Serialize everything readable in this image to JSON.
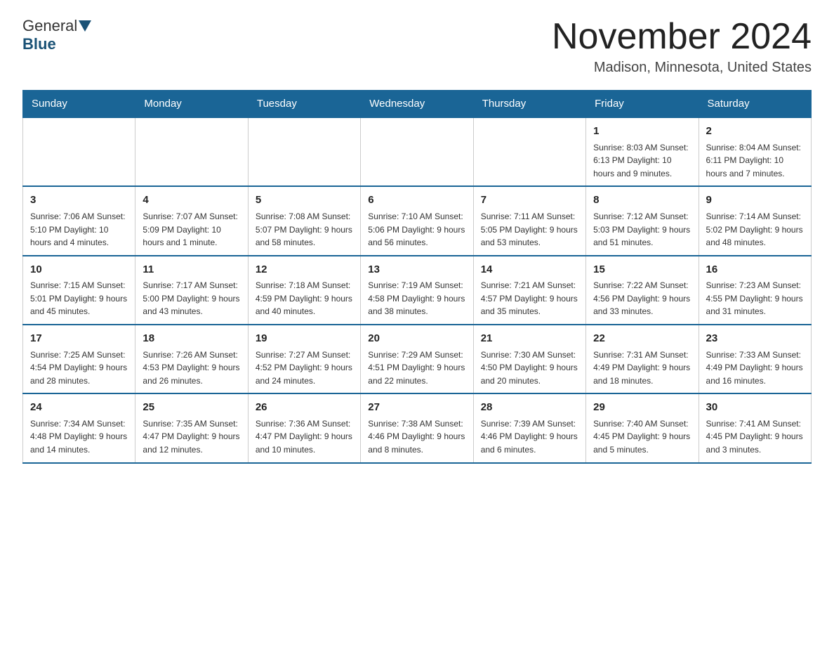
{
  "header": {
    "logo_general": "General",
    "logo_blue": "Blue",
    "month_title": "November 2024",
    "location": "Madison, Minnesota, United States"
  },
  "calendar": {
    "days_of_week": [
      "Sunday",
      "Monday",
      "Tuesday",
      "Wednesday",
      "Thursday",
      "Friday",
      "Saturday"
    ],
    "weeks": [
      [
        {
          "day": "",
          "info": ""
        },
        {
          "day": "",
          "info": ""
        },
        {
          "day": "",
          "info": ""
        },
        {
          "day": "",
          "info": ""
        },
        {
          "day": "",
          "info": ""
        },
        {
          "day": "1",
          "info": "Sunrise: 8:03 AM\nSunset: 6:13 PM\nDaylight: 10 hours and 9 minutes."
        },
        {
          "day": "2",
          "info": "Sunrise: 8:04 AM\nSunset: 6:11 PM\nDaylight: 10 hours and 7 minutes."
        }
      ],
      [
        {
          "day": "3",
          "info": "Sunrise: 7:06 AM\nSunset: 5:10 PM\nDaylight: 10 hours and 4 minutes."
        },
        {
          "day": "4",
          "info": "Sunrise: 7:07 AM\nSunset: 5:09 PM\nDaylight: 10 hours and 1 minute."
        },
        {
          "day": "5",
          "info": "Sunrise: 7:08 AM\nSunset: 5:07 PM\nDaylight: 9 hours and 58 minutes."
        },
        {
          "day": "6",
          "info": "Sunrise: 7:10 AM\nSunset: 5:06 PM\nDaylight: 9 hours and 56 minutes."
        },
        {
          "day": "7",
          "info": "Sunrise: 7:11 AM\nSunset: 5:05 PM\nDaylight: 9 hours and 53 minutes."
        },
        {
          "day": "8",
          "info": "Sunrise: 7:12 AM\nSunset: 5:03 PM\nDaylight: 9 hours and 51 minutes."
        },
        {
          "day": "9",
          "info": "Sunrise: 7:14 AM\nSunset: 5:02 PM\nDaylight: 9 hours and 48 minutes."
        }
      ],
      [
        {
          "day": "10",
          "info": "Sunrise: 7:15 AM\nSunset: 5:01 PM\nDaylight: 9 hours and 45 minutes."
        },
        {
          "day": "11",
          "info": "Sunrise: 7:17 AM\nSunset: 5:00 PM\nDaylight: 9 hours and 43 minutes."
        },
        {
          "day": "12",
          "info": "Sunrise: 7:18 AM\nSunset: 4:59 PM\nDaylight: 9 hours and 40 minutes."
        },
        {
          "day": "13",
          "info": "Sunrise: 7:19 AM\nSunset: 4:58 PM\nDaylight: 9 hours and 38 minutes."
        },
        {
          "day": "14",
          "info": "Sunrise: 7:21 AM\nSunset: 4:57 PM\nDaylight: 9 hours and 35 minutes."
        },
        {
          "day": "15",
          "info": "Sunrise: 7:22 AM\nSunset: 4:56 PM\nDaylight: 9 hours and 33 minutes."
        },
        {
          "day": "16",
          "info": "Sunrise: 7:23 AM\nSunset: 4:55 PM\nDaylight: 9 hours and 31 minutes."
        }
      ],
      [
        {
          "day": "17",
          "info": "Sunrise: 7:25 AM\nSunset: 4:54 PM\nDaylight: 9 hours and 28 minutes."
        },
        {
          "day": "18",
          "info": "Sunrise: 7:26 AM\nSunset: 4:53 PM\nDaylight: 9 hours and 26 minutes."
        },
        {
          "day": "19",
          "info": "Sunrise: 7:27 AM\nSunset: 4:52 PM\nDaylight: 9 hours and 24 minutes."
        },
        {
          "day": "20",
          "info": "Sunrise: 7:29 AM\nSunset: 4:51 PM\nDaylight: 9 hours and 22 minutes."
        },
        {
          "day": "21",
          "info": "Sunrise: 7:30 AM\nSunset: 4:50 PM\nDaylight: 9 hours and 20 minutes."
        },
        {
          "day": "22",
          "info": "Sunrise: 7:31 AM\nSunset: 4:49 PM\nDaylight: 9 hours and 18 minutes."
        },
        {
          "day": "23",
          "info": "Sunrise: 7:33 AM\nSunset: 4:49 PM\nDaylight: 9 hours and 16 minutes."
        }
      ],
      [
        {
          "day": "24",
          "info": "Sunrise: 7:34 AM\nSunset: 4:48 PM\nDaylight: 9 hours and 14 minutes."
        },
        {
          "day": "25",
          "info": "Sunrise: 7:35 AM\nSunset: 4:47 PM\nDaylight: 9 hours and 12 minutes."
        },
        {
          "day": "26",
          "info": "Sunrise: 7:36 AM\nSunset: 4:47 PM\nDaylight: 9 hours and 10 minutes."
        },
        {
          "day": "27",
          "info": "Sunrise: 7:38 AM\nSunset: 4:46 PM\nDaylight: 9 hours and 8 minutes."
        },
        {
          "day": "28",
          "info": "Sunrise: 7:39 AM\nSunset: 4:46 PM\nDaylight: 9 hours and 6 minutes."
        },
        {
          "day": "29",
          "info": "Sunrise: 7:40 AM\nSunset: 4:45 PM\nDaylight: 9 hours and 5 minutes."
        },
        {
          "day": "30",
          "info": "Sunrise: 7:41 AM\nSunset: 4:45 PM\nDaylight: 9 hours and 3 minutes."
        }
      ]
    ]
  }
}
